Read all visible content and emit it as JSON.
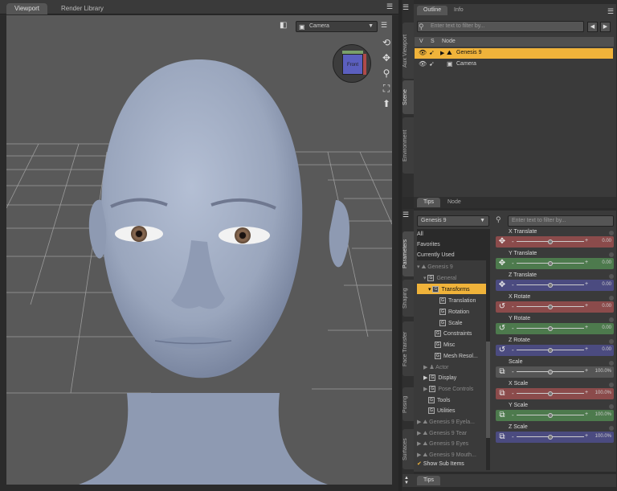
{
  "viewport": {
    "tabs": [
      "Viewport",
      "Render Library"
    ],
    "camera_select": "Camera",
    "cube_label": "Front"
  },
  "right_top": {
    "side_tabs": [
      "Aux Viewport",
      "Scene",
      "Environment"
    ],
    "tabs": [
      "Outline",
      "Info"
    ],
    "filter_placeholder": "Enter text to filter by...",
    "columns": [
      "V",
      "S",
      "Node"
    ],
    "nodes": [
      {
        "name": "Genesis 9",
        "selected": true
      },
      {
        "name": "Camera",
        "selected": false
      }
    ],
    "bottom_tabs": [
      "Tips",
      "Node"
    ]
  },
  "params": {
    "side_tabs": [
      "Parameters",
      "Shaping",
      "Face Transfer",
      "Posing",
      "Surfaces"
    ],
    "figure_select": "Genesis 9",
    "filter_placeholder": "Enter text to filter by...",
    "tree": [
      "All",
      "Favorites",
      "Currently Used",
      "Genesis 9",
      "General",
      "Transforms",
      "Translation",
      "Rotation",
      "Scale",
      "Constraints",
      "Misc",
      "Mesh Resol...",
      "Actor",
      "Display",
      "Pose Controls",
      "Tools",
      "Utilities",
      "Genesis 9 Eyela...",
      "Genesis 9 Tear",
      "Genesis 9 Eyes",
      "Genesis 9 Mouth..."
    ],
    "show_sub_items": "Show Sub Items",
    "sliders": [
      {
        "label": "X Translate",
        "value": "0.00",
        "color": "#8b4b4b",
        "level": 0.5
      },
      {
        "label": "Y Translate",
        "value": "0.00",
        "color": "#4d7a4d",
        "level": 0.5
      },
      {
        "label": "Z Translate",
        "value": "0.00",
        "color": "#4b4b80",
        "level": 0.5
      },
      {
        "label": "X Rotate",
        "value": "0.00",
        "color": "#8b4b4b",
        "level": 0.5
      },
      {
        "label": "Y Rotate",
        "value": "0.00",
        "color": "#4d7a4d",
        "level": 0.5
      },
      {
        "label": "Z Rotate",
        "value": "0.00",
        "color": "#4b4b80",
        "level": 0.5
      },
      {
        "label": "Scale",
        "value": "100.0%",
        "color": "#555555",
        "level": 0.5
      },
      {
        "label": "X Scale",
        "value": "100.0%",
        "color": "#8b4b4b",
        "level": 0.5
      },
      {
        "label": "Y Scale",
        "value": "100.0%",
        "color": "#4d7a4d",
        "level": 0.5
      },
      {
        "label": "Z Scale",
        "value": "100.0%",
        "color": "#4b4b80",
        "level": 0.5
      }
    ],
    "bottom_tab": "Tips"
  }
}
